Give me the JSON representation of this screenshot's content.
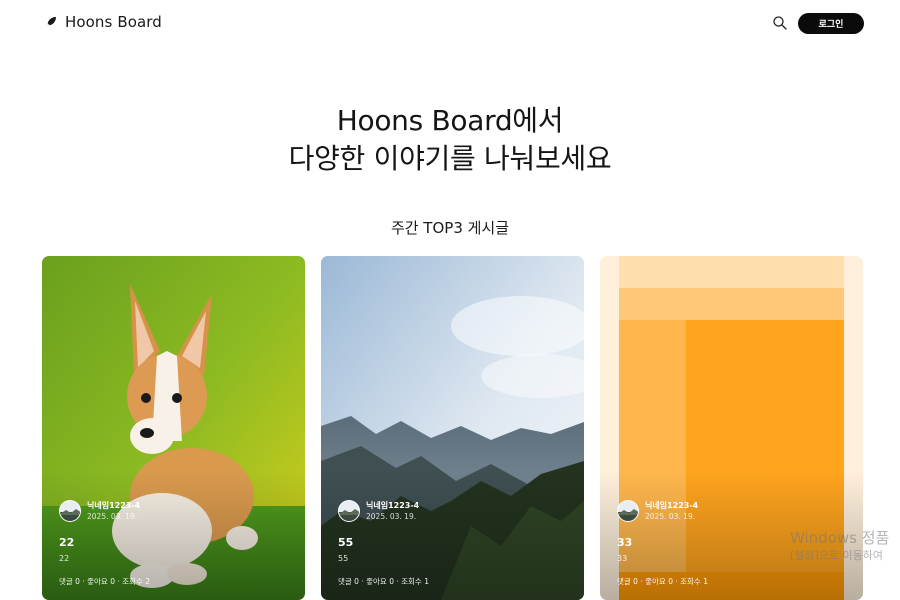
{
  "header": {
    "logo_text": "Hoons Board",
    "logo_icon": "feather-icon",
    "search_icon": "search-icon",
    "login_label": "로그인"
  },
  "hero": {
    "line1": "Hoons Board에서",
    "line2": "다양한 이야기를 나눠보세요"
  },
  "section": {
    "title": "주간 TOP3 게시글"
  },
  "cards": [
    {
      "image": "corgi-puppy-photo",
      "author": "닉네임1223-4",
      "date": "2025. 03. 19.",
      "title": "22",
      "body": "22",
      "stats": "댓글 0 · 좋아요 0 · 조회수 2"
    },
    {
      "image": "mountain-landscape-photo",
      "author": "닉네임1223-4",
      "date": "2025. 03. 19.",
      "title": "55",
      "body": "55",
      "stats": "댓글 0 · 좋아요 0 · 조회수 1"
    },
    {
      "image": "orange-blocks-image",
      "author": "닉네임1223-4",
      "date": "2025. 03. 19.",
      "title": "33",
      "body": "33",
      "stats": "댓글 0 · 좋아요 0 · 조회수 1"
    }
  ],
  "watermark": {
    "line1": "Windows 정품",
    "line2": "[설정]으로 이동하여"
  },
  "colors": {
    "login_bg": "#0b0b0b",
    "orange": "#ffa51e"
  }
}
